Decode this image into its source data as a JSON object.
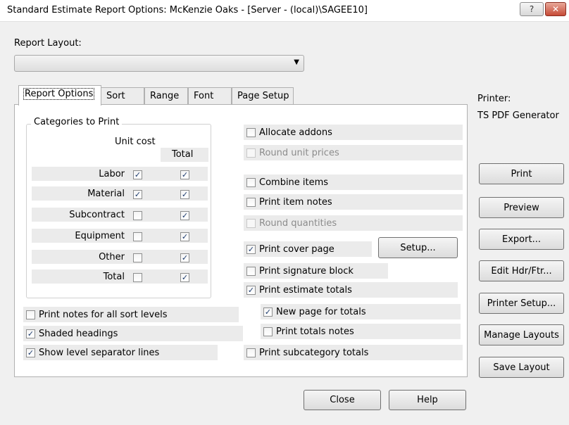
{
  "window": {
    "title": "Standard Estimate Report Options: McKenzie Oaks - [Server - (local)\\SAGEE10]",
    "help_glyph": "?",
    "close_glyph": "✕"
  },
  "report_layout": {
    "label": "Report Layout:",
    "value": ""
  },
  "tabs": [
    {
      "label": "Report Options",
      "active": true
    },
    {
      "label": "Sort"
    },
    {
      "label": "Range"
    },
    {
      "label": "Font"
    },
    {
      "label": "Page Setup"
    }
  ],
  "categories": {
    "title": "Categories to Print",
    "col_unit_cost": "Unit cost",
    "col_total": "Total",
    "rows": [
      {
        "label": "Labor",
        "unit_cost": true,
        "total": true
      },
      {
        "label": "Material",
        "unit_cost": true,
        "total": true
      },
      {
        "label": "Subcontract",
        "unit_cost": false,
        "total": true
      },
      {
        "label": "Equipment",
        "unit_cost": false,
        "total": true
      },
      {
        "label": "Other",
        "unit_cost": false,
        "total": true
      },
      {
        "label": "Total",
        "unit_cost": false,
        "total": true
      }
    ]
  },
  "left_options": [
    {
      "label": "Print notes for all sort levels",
      "checked": false
    },
    {
      "label": "Shaded headings",
      "checked": true
    },
    {
      "label": "Show level separator lines",
      "checked": true
    }
  ],
  "right_options": {
    "allocate_addons": {
      "label": "Allocate addons",
      "checked": false
    },
    "round_unit_prices": {
      "label": "Round unit prices",
      "checked": false,
      "disabled": true
    },
    "combine_items": {
      "label": "Combine items",
      "checked": false
    },
    "print_item_notes": {
      "label": "Print item notes",
      "checked": false
    },
    "round_quantities": {
      "label": "Round quantities",
      "checked": false,
      "disabled": true
    },
    "print_cover_page": {
      "label": "Print cover page",
      "checked": true
    },
    "print_signature_block": {
      "label": "Print signature block",
      "checked": false
    },
    "print_estimate_totals": {
      "label": "Print estimate totals",
      "checked": true
    },
    "new_page_for_totals": {
      "label": "New page for totals",
      "checked": true
    },
    "print_totals_notes": {
      "label": "Print totals notes",
      "checked": false
    },
    "print_subcategory_totals": {
      "label": "Print subcategory totals",
      "checked": false
    }
  },
  "setup_button": "Setup...",
  "printer": {
    "label": "Printer:",
    "name": "TS PDF Generator"
  },
  "side_buttons": {
    "print": "Print",
    "preview": "Preview",
    "export": "Export...",
    "edit_hdr_ftr": "Edit Hdr/Ftr...",
    "printer_setup": "Printer Setup...",
    "manage_layouts": "Manage Layouts",
    "save_layout": "Save Layout"
  },
  "bottom_buttons": {
    "close": "Close",
    "help": "Help"
  },
  "check_glyph": "✓"
}
